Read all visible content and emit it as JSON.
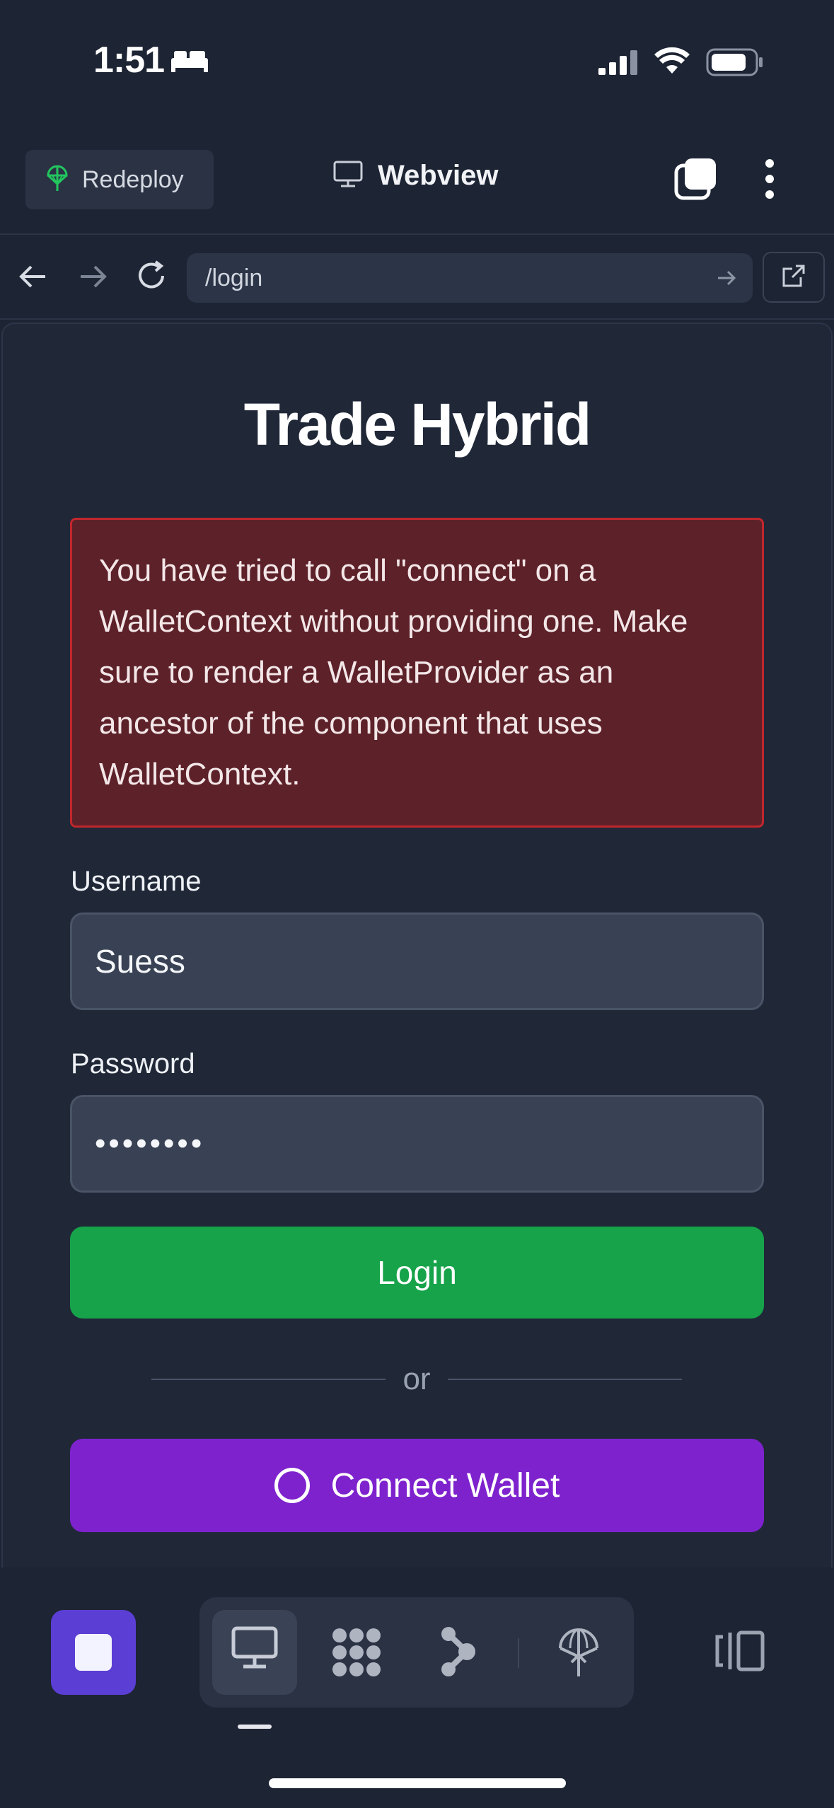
{
  "status_bar": {
    "time": "1:51",
    "icons": [
      "bed-icon",
      "cellular-signal-icon",
      "wifi-icon",
      "battery-icon"
    ]
  },
  "app_bar": {
    "redeploy_label": "Redeploy",
    "title": "Webview",
    "icons": [
      "redeploy-icon",
      "monitor-icon",
      "tabs-icon",
      "more-vertical-icon"
    ]
  },
  "url_bar": {
    "url": "/login",
    "icons": [
      "back-arrow-icon",
      "forward-arrow-icon",
      "reload-icon",
      "go-arrow-icon",
      "external-link-icon"
    ]
  },
  "page": {
    "title": "Trade Hybrid",
    "error_message": "You have tried to call \"connect\" on a WalletContext without providing one. Make sure to render a WalletProvider as an ancestor of the component that uses WalletContext.",
    "username_label": "Username",
    "username_value": "Suess",
    "password_label": "Password",
    "password_value": "••••••••",
    "login_label": "Login",
    "or_label": "or",
    "connect_wallet_label": "Connect Wallet"
  },
  "bottom_toolbar": {
    "items": [
      "stop-icon",
      "desktop-icon",
      "grid-dots-icon",
      "nodes-icon",
      "deploy-globe-icon",
      "panel-toggle-icon"
    ],
    "active_item": "desktop-icon"
  },
  "colors": {
    "background": "#1d2433",
    "error_bg": "#5d2129",
    "error_border": "#c0272d",
    "login_green": "#16a34a",
    "wallet_purple": "#7e22ce",
    "stop_purple": "#5b3fd4"
  }
}
